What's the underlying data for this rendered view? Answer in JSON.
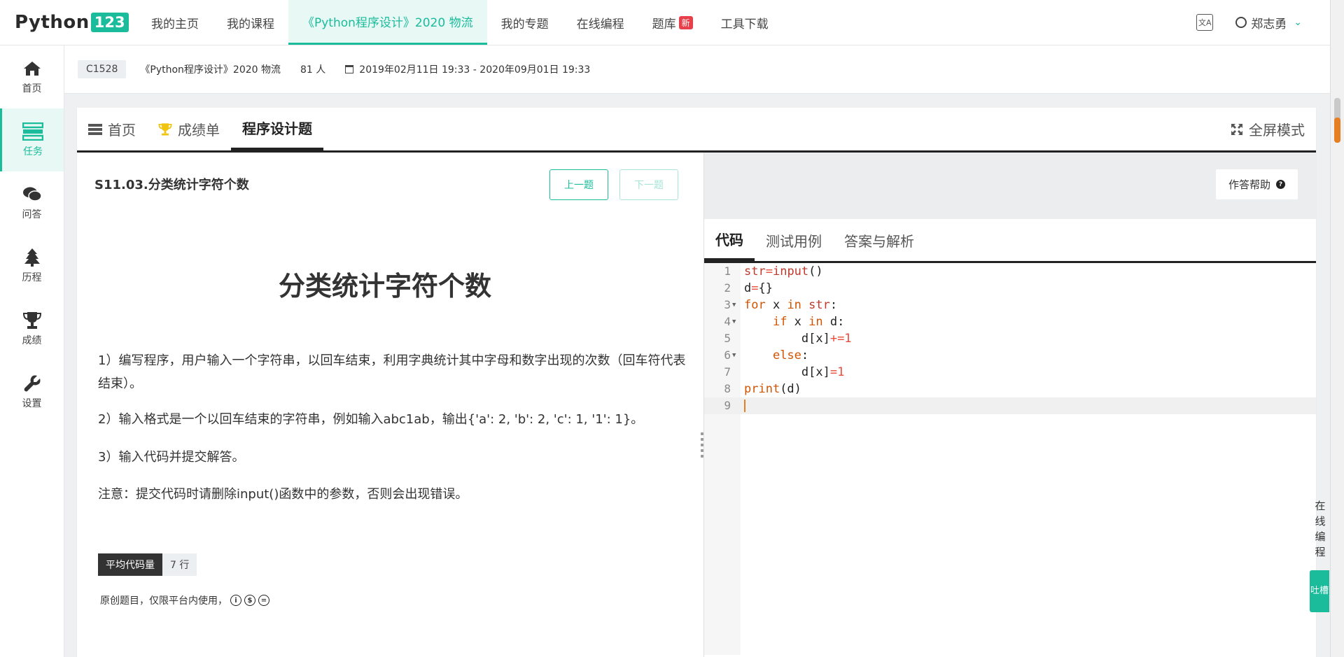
{
  "topnav": {
    "logo_text": "Python",
    "logo_num": "123",
    "items": [
      {
        "label": "我的主页"
      },
      {
        "label": "我的课程"
      },
      {
        "label": "《Python程序设计》2020 物流"
      },
      {
        "label": "我的专题"
      },
      {
        "label": "在线编程"
      },
      {
        "label": "题库"
      },
      {
        "label": "工具下载"
      }
    ],
    "new_badge": "新",
    "user_name": "郑志勇",
    "accent_color": "#1abc9c"
  },
  "sidebar": {
    "items": [
      {
        "label": "首页",
        "icon": "home-icon"
      },
      {
        "label": "任务",
        "icon": "task-icon"
      },
      {
        "label": "问答",
        "icon": "chat-icon"
      },
      {
        "label": "历程",
        "icon": "tree-icon"
      },
      {
        "label": "成绩",
        "icon": "trophy-icon"
      },
      {
        "label": "设置",
        "icon": "wrench-icon"
      }
    ]
  },
  "course": {
    "code": "C1528",
    "name": "《Python程序设计》2020 物流",
    "count": "81 人",
    "date": "2019年02月11日 19:33 - 2020年09月01日 19:33"
  },
  "tabs": {
    "home": "首页",
    "scores": "成绩单",
    "programming": "程序设计题",
    "fullscreen": "全屏模式"
  },
  "problem": {
    "title": "S11.03.分类统计字符个数",
    "prev": "上一题",
    "next": "下一题",
    "heading": "分类统计字符个数",
    "p1": "1）编写程序，用户输入一个字符串，以回车结束，利用字典统计其中字母和数字出现的次数（回车符代表结束）。",
    "p2": "2）输入格式是一个以回车结束的字符串，例如输入abc1ab，输出{'a': 2, 'b': 2, 'c': 1, '1': 1}。",
    "p3": "3）输入代码并提交解答。",
    "p4": "注意：提交代码时请删除input()函数中的参数，否则会出现错误。",
    "stat_label": "平均代码量",
    "stat_value": "7 行",
    "license": "原创题目，仅限平台内使用，"
  },
  "editor": {
    "help": "作答帮助",
    "tabs": [
      "代码",
      "测试用例",
      "答案与解析"
    ],
    "line_numbers": [
      "1",
      "2",
      "3",
      "4",
      "5",
      "6",
      "7",
      "8",
      "9"
    ]
  },
  "float": {
    "online": "在线编程",
    "tucao": "吐槽"
  }
}
